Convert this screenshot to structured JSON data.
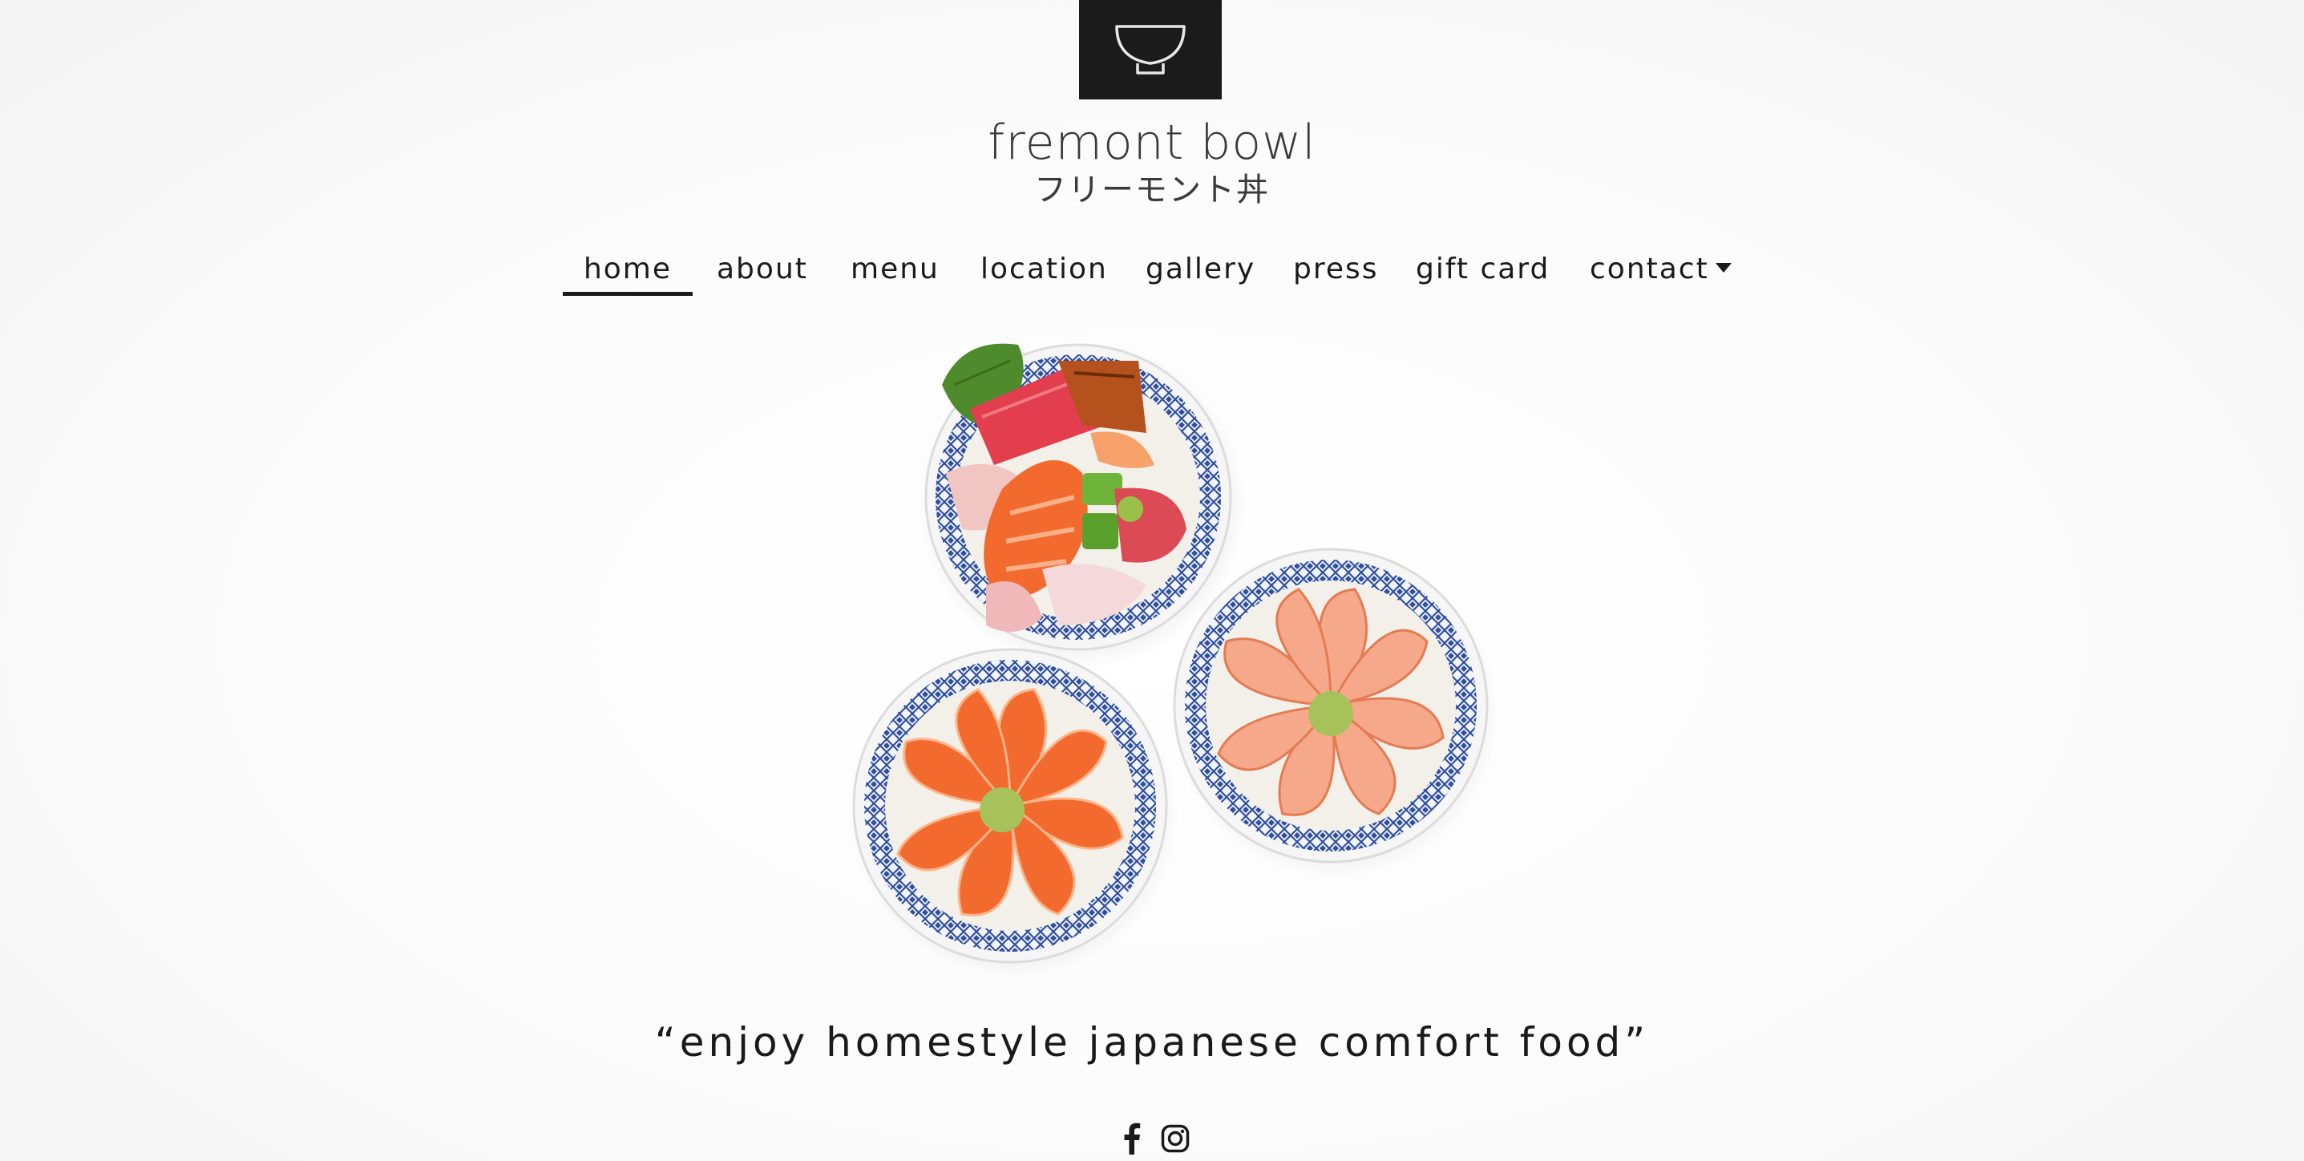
{
  "brand": {
    "name": "fremont bowl",
    "japanese_name": "フリーモント丼",
    "logo_icon": "bowl-icon"
  },
  "nav": {
    "items": [
      {
        "label": "home",
        "active": true
      },
      {
        "label": "about",
        "active": false
      },
      {
        "label": "menu",
        "active": false
      },
      {
        "label": "location",
        "active": false
      },
      {
        "label": "gallery",
        "active": false
      },
      {
        "label": "press",
        "active": false
      },
      {
        "label": "gift card",
        "active": false
      },
      {
        "label": "contact",
        "active": false,
        "has_dropdown": true
      }
    ]
  },
  "hero": {
    "image_subject": "three donburi bowls"
  },
  "tagline": "“enjoy homestyle japanese comfort food”",
  "social": {
    "icons": [
      "facebook-icon",
      "instagram-icon"
    ]
  },
  "colors": {
    "logo_bg": "#1b1b1b",
    "text": "#1a1a1a",
    "bowl_blue": "#2f4fa0",
    "salmon": "#f26a2e"
  }
}
